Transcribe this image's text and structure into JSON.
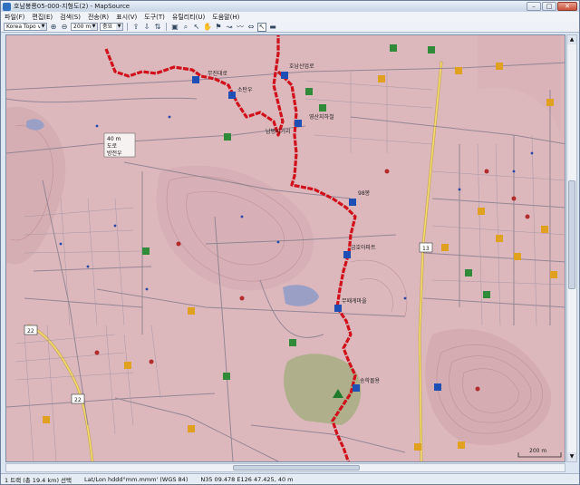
{
  "window": {
    "title": "호남봉룡05-000-지형도(2) - MapSource"
  },
  "menu": [
    "파일(F)",
    "편집(E)",
    "검색(S)",
    "전송(R)",
    "표시(V)",
    "도구(T)",
    "유틸리티(U)",
    "도움말(H)"
  ],
  "toolbar": {
    "map_product": "Korea Topo v9",
    "zoom_scale": "200 m",
    "detail_level": "중요"
  },
  "map": {
    "labels": [
      "호남산업로",
      "무진대로",
      "소탄우",
      "남평사거리",
      "영산지하철",
      "40 m",
      "도로",
      "방전우",
      "98봉",
      "금호아파트",
      "무때게마을",
      "송학몰용",
      "13",
      "22",
      "200 m"
    ],
    "route_color": "#d0101a",
    "map_bg_color": "#dcb8bd"
  },
  "status": {
    "track_info": "1 트랙 (총 19.4 km) 선택",
    "coord_format": "Lat/Lon hddd°mm.mmm' (WGS 84)",
    "cursor_position": "N35 09.478 E126 47.425, 40 m"
  }
}
